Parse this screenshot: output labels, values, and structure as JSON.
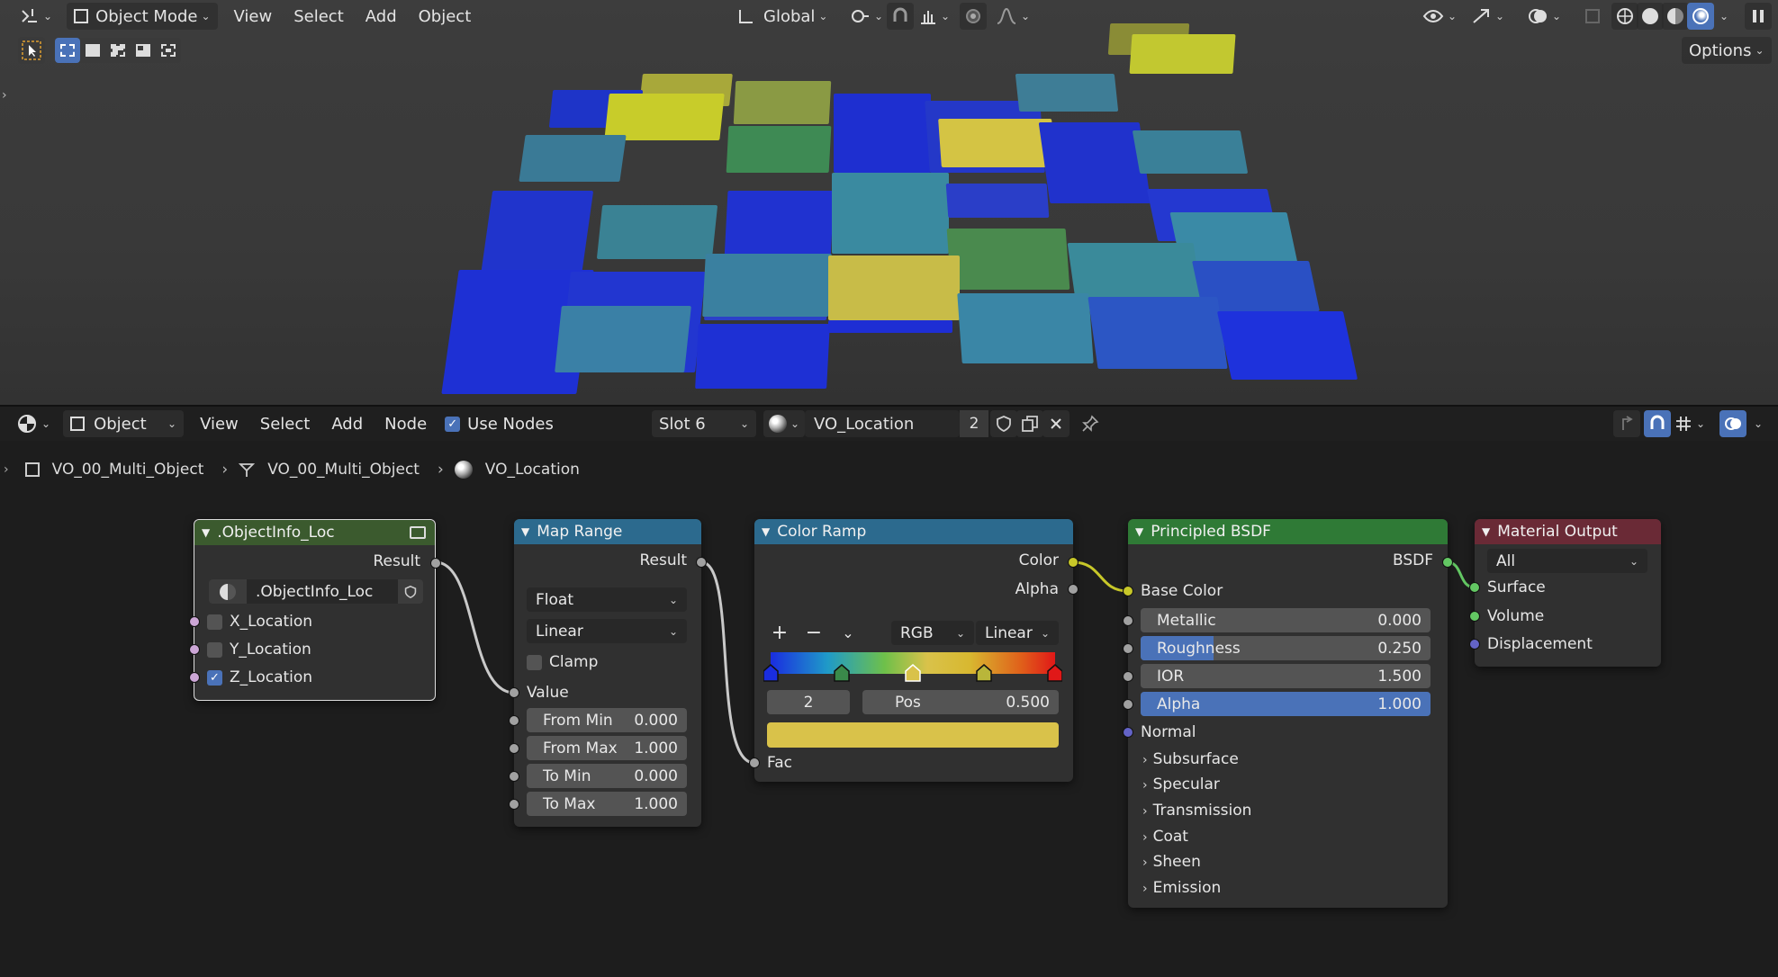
{
  "viewport": {
    "mode": "Object Mode",
    "menus": [
      "View",
      "Select",
      "Add",
      "Object"
    ],
    "orientation": "Global",
    "options_label": "Options",
    "icons": [
      "editor-type-icon",
      "select-box-icon",
      "transform-pivot-icon",
      "snap-icon",
      "proportional-edit-icon",
      "visibility-icon",
      "gizmo-icon",
      "overlay-icon",
      "xray-icon",
      "shading-wireframe-icon",
      "shading-solid-icon",
      "shading-material-icon",
      "shading-rendered-icon"
    ]
  },
  "node_editor": {
    "object_dropdown": "Object",
    "menus": [
      "View",
      "Select",
      "Add",
      "Node"
    ],
    "use_nodes_label": "Use Nodes",
    "use_nodes_checked": true,
    "slot": "Slot 6",
    "material_name": "VO_Location",
    "material_users": "2",
    "breadcrumb": [
      "VO_00_Multi_Object",
      "VO_00_Multi_Object",
      "VO_Location"
    ]
  },
  "nodes": {
    "objectinfo": {
      "title": ".ObjectInfo_Loc",
      "output": "Result",
      "group_name": ".ObjectInfo_Loc",
      "inputs": [
        {
          "label": "X_Location",
          "checked": false
        },
        {
          "label": "Y_Location",
          "checked": false
        },
        {
          "label": "Z_Location",
          "checked": true
        }
      ]
    },
    "map_range": {
      "title": "Map Range",
      "output": "Result",
      "data_type": "Float",
      "interpolation": "Linear",
      "clamp_label": "Clamp",
      "clamp": false,
      "value_label": "Value",
      "fields": [
        {
          "label": "From Min",
          "value": "0.000"
        },
        {
          "label": "From Max",
          "value": "1.000"
        },
        {
          "label": "To Min",
          "value": "0.000"
        },
        {
          "label": "To Max",
          "value": "1.000"
        }
      ]
    },
    "color_ramp": {
      "title": "Color Ramp",
      "outputs": [
        "Color",
        "Alpha"
      ],
      "color_mode": "RGB",
      "interpolation": "Linear",
      "active_index": "2",
      "pos_label": "Pos",
      "pos_value": "0.500",
      "input": "Fac",
      "stops": [
        {
          "pos": 0.0,
          "color": "#1a2de0"
        },
        {
          "pos": 0.25,
          "color": "#3a8a4a"
        },
        {
          "pos": 0.5,
          "color": "#d9c24a"
        },
        {
          "pos": 0.75,
          "color": "#b9b63a"
        },
        {
          "pos": 1.0,
          "color": "#e01818"
        }
      ],
      "selected_color": "#d9c24a"
    },
    "principled": {
      "title": "Principled BSDF",
      "output": "BSDF",
      "base_color_label": "Base Color",
      "fields": [
        {
          "label": "Metallic",
          "value": "0.000",
          "fill": 0.0
        },
        {
          "label": "Roughness",
          "value": "0.250",
          "fill": 0.25
        },
        {
          "label": "IOR",
          "value": "1.500",
          "fill": 0.0
        },
        {
          "label": "Alpha",
          "value": "1.000",
          "fill": 1.0
        }
      ],
      "normal_label": "Normal",
      "panels": [
        "Subsurface",
        "Specular",
        "Transmission",
        "Coat",
        "Sheen",
        "Emission"
      ]
    },
    "material_output": {
      "title": "Material Output",
      "target": "All",
      "inputs": [
        "Surface",
        "Volume",
        "Displacement"
      ]
    }
  },
  "colors": {
    "accent": "#4a72b8",
    "header_group": "#3b5a2e",
    "header_converter": "#2c6a8e",
    "header_shader": "#2f7a36",
    "header_output": "#6a2a36",
    "socket_float": "#a1a1a1",
    "socket_color": "#c7c729",
    "socket_shader": "#63c763",
    "socket_vector": "#6363c7",
    "socket_bool": "#cca6d6"
  }
}
